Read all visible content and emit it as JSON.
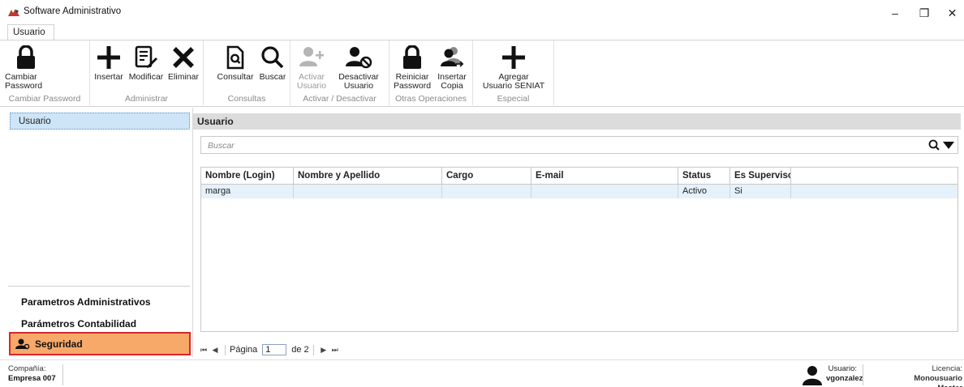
{
  "window": {
    "title": "Software Administrativo",
    "controls": {
      "minimize": "–",
      "maximize": "❐",
      "close": "✕"
    }
  },
  "ribbon": {
    "tab": "Usuario",
    "groups": [
      {
        "label": "Cambiar Password",
        "buttons": [
          {
            "label": "Cambiar\nPassword",
            "icon": "lock-icon"
          }
        ]
      },
      {
        "label": "Administrar",
        "buttons": [
          {
            "label": "Insertar",
            "icon": "plus-icon"
          },
          {
            "label": "Modificar",
            "icon": "edit-icon"
          },
          {
            "label": "Eliminar",
            "icon": "x-icon"
          }
        ]
      },
      {
        "label": "Consultas",
        "buttons": [
          {
            "label": "Consultar",
            "icon": "document-search-icon"
          },
          {
            "label": "Buscar",
            "icon": "search-icon"
          }
        ]
      },
      {
        "label": "Activar / Desactivar",
        "buttons": [
          {
            "label": "Activar\nUsuario",
            "icon": "user-add-icon",
            "disabled": true
          },
          {
            "label": "Desactivar\nUsuario",
            "icon": "user-block-icon"
          }
        ]
      },
      {
        "label": "Otras Operaciones",
        "buttons": [
          {
            "label": "Reiniciar\nPassword",
            "icon": "lock-icon"
          },
          {
            "label": "Insertar\nCopia",
            "icon": "users-copy-icon"
          }
        ]
      },
      {
        "label": "Especial",
        "buttons": [
          {
            "label": "Agregar\nUsuario SENIAT",
            "icon": "plus-icon"
          }
        ]
      }
    ]
  },
  "sidebar": {
    "selected_item": "Usuario",
    "sections": [
      "Parametros Administrativos",
      "Parámetros Contabilidad",
      "Seguridad"
    ],
    "active_section_color": "#f7a96a",
    "highlight_border_color": "#d8262a"
  },
  "main": {
    "title": "Usuario",
    "search_placeholder": "Buscar",
    "columns": [
      "Nombre (Login)",
      "Nombre y Apellido",
      "Cargo",
      "E-mail",
      "Status",
      "Es Superviso"
    ],
    "rows": [
      [
        "marga",
        "",
        "",
        "",
        "Activo",
        "Si"
      ]
    ],
    "pager": {
      "label": "Página",
      "current": "1",
      "total_text": "de 2"
    }
  },
  "statusbar": {
    "company_label": "Compañía:",
    "company": "Empresa 007",
    "user_label": "Usuario:",
    "user": "vgonzalez",
    "license_label": "Licencia:",
    "license_value": "Monousuario",
    "license_type": "Master"
  }
}
